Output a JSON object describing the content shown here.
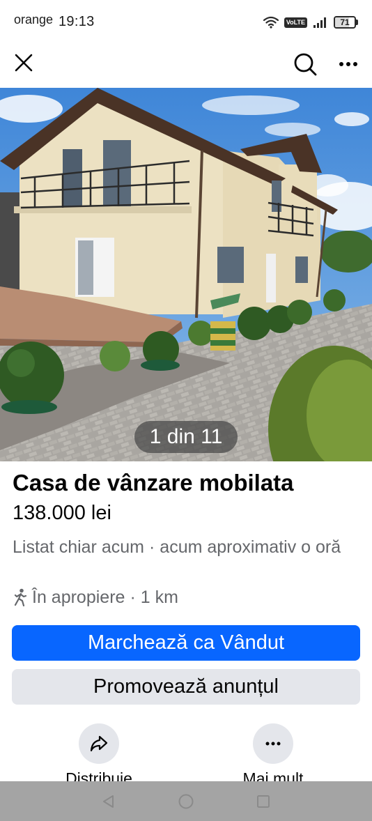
{
  "status_bar": {
    "carrier": "orange",
    "time": "19:13",
    "network_badge": "VoLTE",
    "battery": "71",
    "battery_level": 0.71,
    "icons": [
      "wifi-icon",
      "signal-icon",
      "battery-icon"
    ]
  },
  "top_bar": {
    "icons": [
      "close-icon",
      "search-icon",
      "more-dots-icon"
    ]
  },
  "photo": {
    "counter": "1 din 11",
    "description_icon": "house-photo"
  },
  "listing": {
    "title": "Casa de vânzare mobilata",
    "price": "138.000 lei",
    "listed_time": "Listat chiar acum",
    "separator": "·",
    "updated_time": "acum aproximativ o oră",
    "location_label": "În apropiere",
    "distance": "1 km"
  },
  "buttons": {
    "mark_sold": "Marchează ca Vândut",
    "promote": "Promovează anunțul"
  },
  "actions": {
    "share": "Distribuie",
    "more": "Mai mult"
  },
  "colors": {
    "primary": "#0866ff",
    "secondary_button": "#e4e6eb",
    "muted_text": "#65676b",
    "nav_bar": "#a4a4a4"
  }
}
